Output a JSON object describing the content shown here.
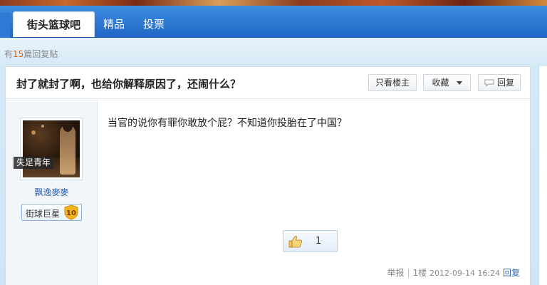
{
  "nav": {
    "tabs": [
      {
        "label": "街头篮球吧",
        "active": true
      },
      {
        "label": "精品",
        "active": false
      },
      {
        "label": "投票",
        "active": false
      }
    ]
  },
  "thread": {
    "reply_prefix": "有",
    "reply_count": "15",
    "reply_suffix": "篇回复贴",
    "title": "封了就封了啊，也给你解释原因了，还闹什么？",
    "buttons": {
      "only_op": "只看楼主",
      "favorite": "收藏",
      "reply": "回复"
    }
  },
  "post": {
    "author": {
      "signature_tag": "失足青年",
      "username": "飘逸麥麥",
      "level_name": "街球巨星",
      "level": "10"
    },
    "content": "当官的说你有罪你敢放个屁？不知道你投胎在了中国？",
    "likes": "1",
    "footer": {
      "report": "举报",
      "floor": "1楼",
      "time": "2012-09-14 16:24",
      "reply": "回复"
    }
  },
  "colors": {
    "nav_blue": "#1f66c6",
    "link_blue": "#2d64b3",
    "count_orange": "#e05a00",
    "badge_gold": "#f3b51e"
  }
}
